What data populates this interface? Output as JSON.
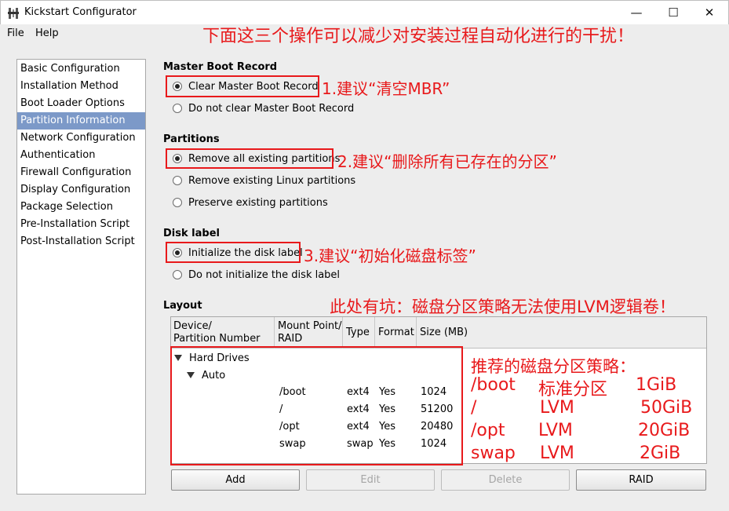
{
  "window": {
    "title": "Kickstart Configurator",
    "min_glyph": "—",
    "max_glyph": "☐",
    "close_glyph": "✕"
  },
  "menu": [
    "File",
    "Help"
  ],
  "annotation_top": "下面这三个操作可以减少对安装过程自动化进行的干扰！",
  "sidebar": {
    "items": [
      "Basic Configuration",
      "Installation Method",
      "Boot Loader Options",
      "Partition Information",
      "Network Configuration",
      "Authentication",
      "Firewall Configuration",
      "Display Configuration",
      "Package Selection",
      "Pre-Installation Script",
      "Post-Installation Script"
    ],
    "selected": "Partition Information"
  },
  "mbr": {
    "title": "Master Boot Record",
    "options": [
      "Clear Master Boot Record",
      "Do not clear Master Boot Record"
    ],
    "selected_index": 0,
    "annotation": "1.建议“清空MBR”"
  },
  "partitions": {
    "title": "Partitions",
    "options": [
      "Remove all existing partitions",
      "Remove existing Linux partitions",
      "Preserve existing partitions"
    ],
    "selected_index": 0,
    "annotation": "2.建议“删除所有已存在的分区”"
  },
  "disk_label": {
    "title": "Disk label",
    "options": [
      "Initialize the disk label",
      "Do not initialize the disk label"
    ],
    "selected_index": 0,
    "annotation": "3.建议“初始化磁盘标签”"
  },
  "layout": {
    "title": "Layout",
    "annotation": "此处有坑：磁盘分区策略无法使用LVM逻辑卷！",
    "columns": [
      {
        "line1": "Device/",
        "line2": "Partition Number"
      },
      {
        "line1": "Mount Point/",
        "line2": "RAID"
      },
      {
        "line1": "Type",
        "line2": ""
      },
      {
        "line1": "Format",
        "line2": ""
      },
      {
        "line1": "Size (MB)",
        "line2": ""
      }
    ],
    "tree": {
      "root": "Hard Drives",
      "child": "Auto"
    },
    "rows": [
      {
        "mount": "/boot",
        "type": "ext4",
        "format": "Yes",
        "size": "1024"
      },
      {
        "mount": "/",
        "type": "ext4",
        "format": "Yes",
        "size": "51200"
      },
      {
        "mount": "/opt",
        "type": "ext4",
        "format": "Yes",
        "size": "20480"
      },
      {
        "mount": "swap",
        "type": "swap",
        "format": "Yes",
        "size": "1024"
      }
    ]
  },
  "buttons": {
    "add": "Add",
    "edit": "Edit",
    "delete": "Delete",
    "raid": "RAID"
  },
  "strategy": {
    "title": "推荐的磁盘分区策略：",
    "rows": [
      {
        "mount": "/boot",
        "type": "标准分区",
        "size": "1GiB"
      },
      {
        "mount": "/",
        "type": "LVM",
        "size": "50GiB"
      },
      {
        "mount": "/opt",
        "type": "LVM",
        "size": "20GiB"
      },
      {
        "mount": "swap",
        "type": "LVM",
        "size": "2GiB"
      }
    ]
  },
  "colors": {
    "annotation_red": "#e8191b",
    "selection_blue": "#7c99c8"
  }
}
